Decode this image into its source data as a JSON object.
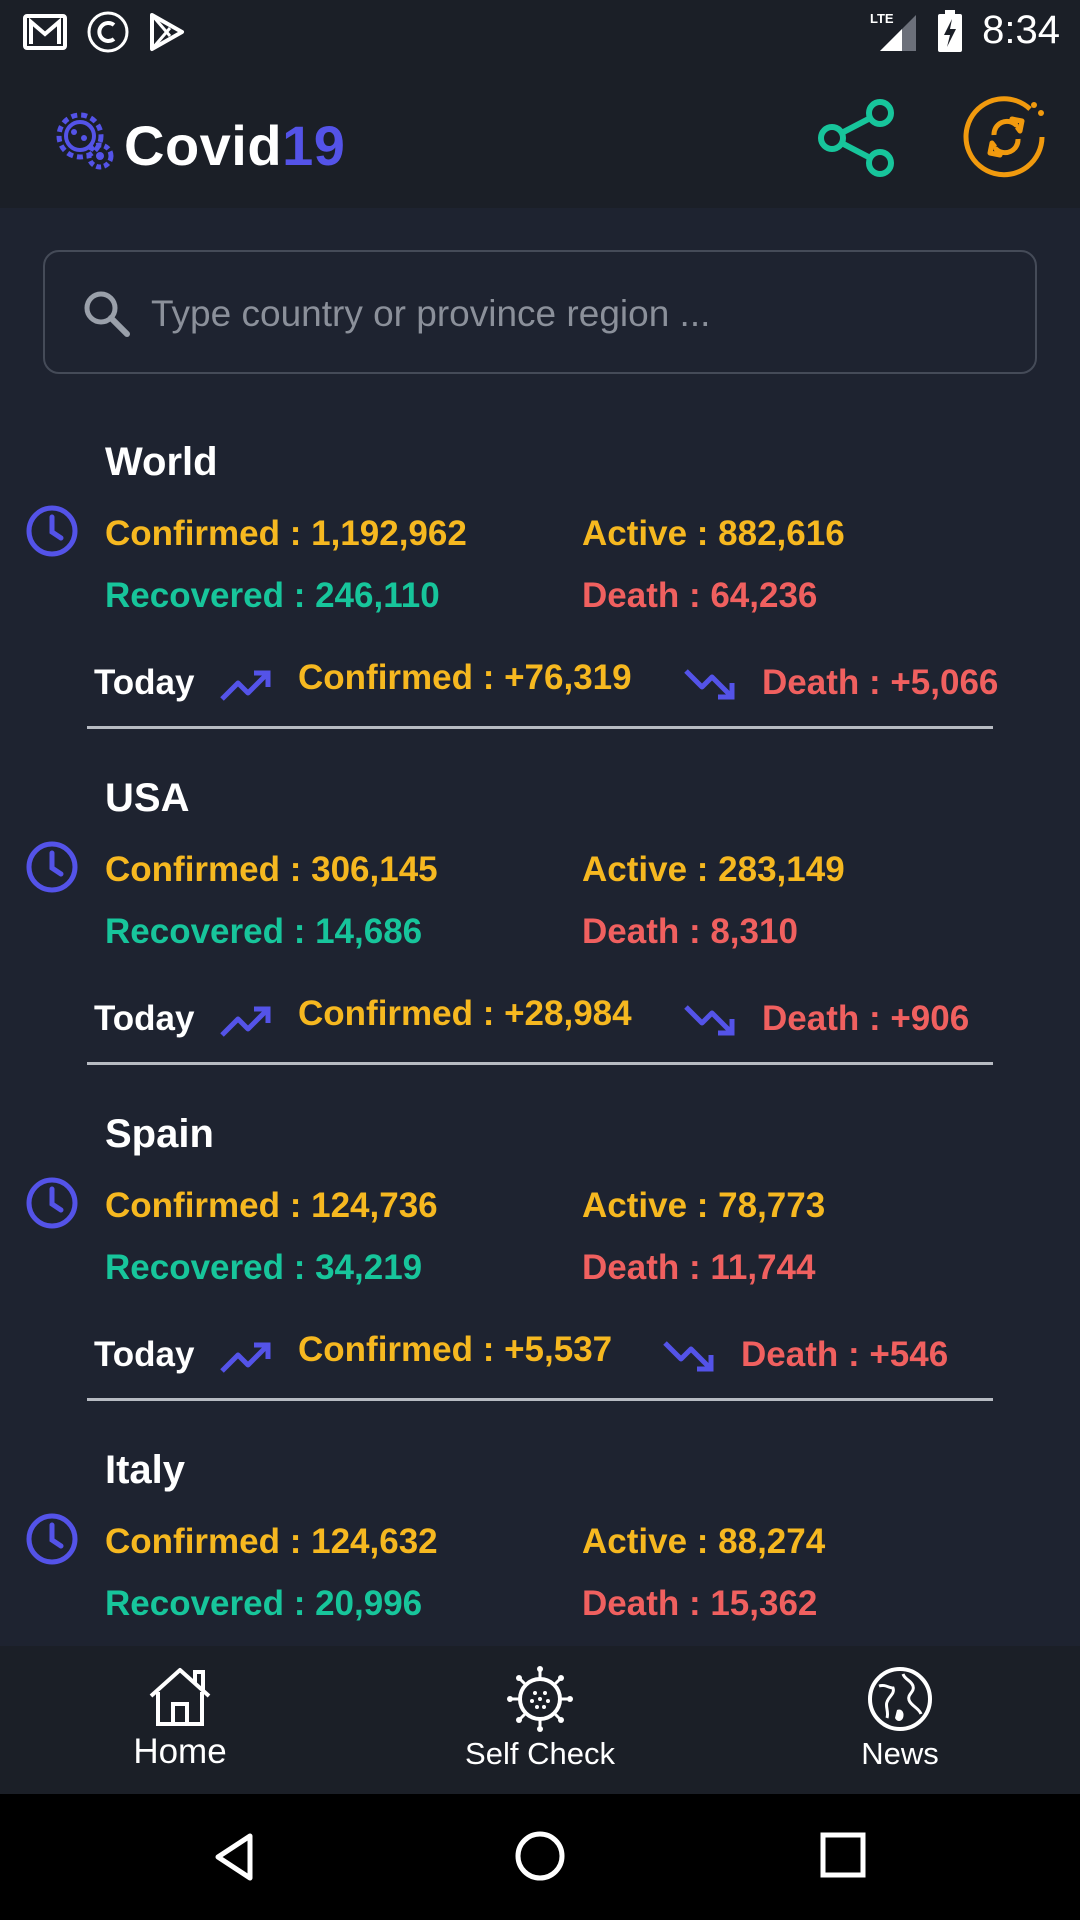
{
  "status_bar": {
    "time": "8:34",
    "network": "LTE"
  },
  "app": {
    "title_a": "Covid",
    "title_b": "19"
  },
  "search": {
    "placeholder": "Type country or province region ..."
  },
  "today_label": "Today",
  "cards": [
    {
      "name": "World",
      "confirmed": "Confirmed : 1,192,962",
      "active": "Active : 882,616",
      "recovered": "Recovered : 246,110",
      "death": "Death : 64,236",
      "today_confirmed": "Confirmed : +76,319",
      "today_death": "Death : +5,066"
    },
    {
      "name": "USA",
      "confirmed": "Confirmed : 306,145",
      "active": "Active : 283,149",
      "recovered": "Recovered : 14,686",
      "death": "Death : 8,310",
      "today_confirmed": "Confirmed : +28,984",
      "today_death": "Death : +906"
    },
    {
      "name": "Spain",
      "confirmed": "Confirmed : 124,736",
      "active": "Active : 78,773",
      "recovered": "Recovered : 34,219",
      "death": "Death : 11,744",
      "today_confirmed": "Confirmed : +5,537",
      "today_death": "Death : +546"
    },
    {
      "name": "Italy",
      "confirmed": "Confirmed : 124,632",
      "active": "Active : 88,274",
      "recovered": "Recovered : 20,996",
      "death": "Death : 15,362"
    }
  ],
  "bottom_nav": {
    "home": "Home",
    "self_check": "Self Check",
    "news": "News"
  },
  "colors": {
    "confirmed": "#f6b820",
    "recovered": "#17c59b",
    "death": "#f0605f",
    "accent": "#5453e8",
    "share": "#17c59b",
    "refresh": "#f19a0e"
  }
}
